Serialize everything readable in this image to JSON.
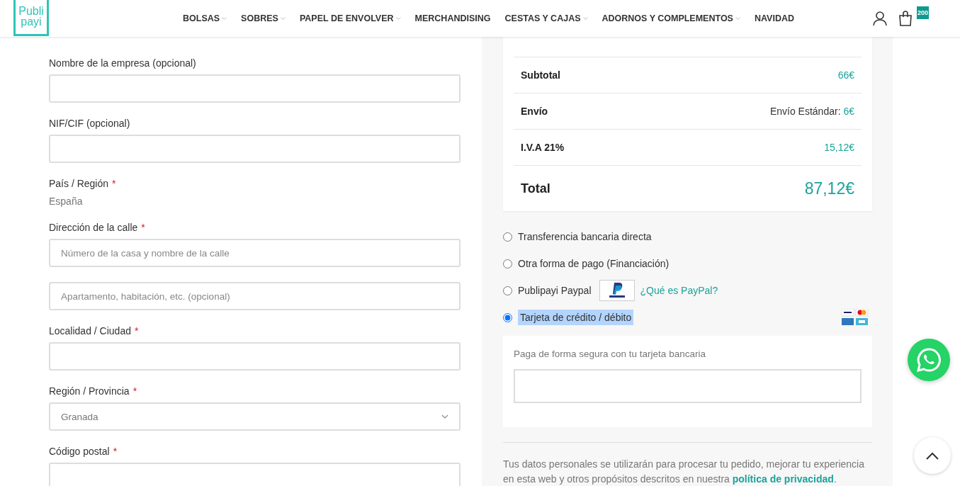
{
  "header": {
    "logo": [
      "Publi",
      "payi"
    ],
    "nav": [
      {
        "label": "BOLSAS",
        "has_dropdown": true
      },
      {
        "label": "SOBRES",
        "has_dropdown": true
      },
      {
        "label": "PAPEL DE ENVOLVER",
        "has_dropdown": true
      },
      {
        "label": "MERCHANDISING",
        "has_dropdown": false
      },
      {
        "label": "CESTAS Y CAJAS",
        "has_dropdown": true
      },
      {
        "label": "ADORNOS Y COMPLEMENTOS",
        "has_dropdown": true
      },
      {
        "label": "NAVIDAD",
        "has_dropdown": false
      }
    ],
    "cart_count": "200"
  },
  "billing_fields": [
    {
      "kind": "input",
      "label": "Nombre de la empresa (opcional)"
    },
    {
      "kind": "input",
      "label": "NIF/CIF (opcional)"
    },
    {
      "kind": "text",
      "label": "País / Región",
      "required_mark": "*",
      "value": "España"
    },
    {
      "kind": "input",
      "label": "Dirección de la calle",
      "required_mark": "*",
      "placeholder": "Número de la casa y nombre de la calle"
    },
    {
      "kind": "input",
      "placeholder": "Apartamento, habitación, etc. (opcional)"
    },
    {
      "kind": "input",
      "label": "Localidad / Ciudad",
      "required_mark": "*"
    },
    {
      "kind": "select",
      "label": "Región / Provincia",
      "required_mark": "*",
      "value": "Granada"
    },
    {
      "kind": "input",
      "label": "Código postal",
      "required_mark": "*"
    }
  ],
  "order_summary": [
    {
      "kind": "subtotal",
      "label": "Subtotal",
      "value": "66€"
    },
    {
      "kind": "shipping",
      "label": "Envío",
      "method": "Envío Estándar:",
      "value": "6€"
    },
    {
      "kind": "tax",
      "label": "I.V.A 21%",
      "value": "15,12€"
    },
    {
      "kind": "total",
      "label": "Total",
      "value": "87,12€"
    }
  ],
  "payment_methods": [
    {
      "kind": "plain",
      "label": "Transferencia bancaria directa",
      "selected": false
    },
    {
      "kind": "plain",
      "label": "Otra forma de pago (Financiación)",
      "selected": false
    },
    {
      "kind": "paypal",
      "label": "Publipayi Paypal",
      "link": "¿Qué es PayPal?",
      "selected": false
    },
    {
      "kind": "card",
      "label": "Tarjeta de crédito / débito",
      "selected": true
    }
  ],
  "card_box": {
    "description": "Paga de forma segura con tu tarjeta bancaria"
  },
  "privacy_notice": {
    "text": "Tus datos personales se utilizarán para procesar tu pedido, mejorar tu experiencia en esta web y otros propósitos descritos en nuestra",
    "link": "política de privacidad",
    "end": "."
  }
}
